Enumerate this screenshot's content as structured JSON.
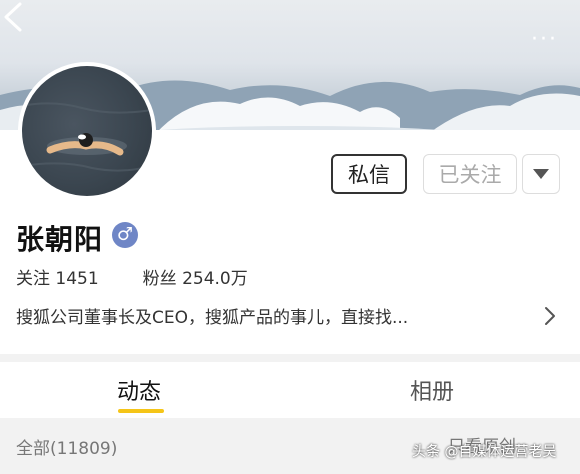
{
  "header": {
    "back_icon": "back-chevron-icon",
    "more_icon": "more-dots-icon",
    "more_text": "···"
  },
  "profile": {
    "name": "张朝阳",
    "gender_icon": "male-icon",
    "gender_symbol": "♂",
    "follow_stat": "关注 1451",
    "fans_stat": "粉丝 254.0万",
    "bio": "搜狐公司董事长及CEO，搜狐产品的事儿，直接找..."
  },
  "actions": {
    "message_label": "私信",
    "followed_label": "已关注"
  },
  "tabs": [
    {
      "label": "动态",
      "active": true
    },
    {
      "label": "相册",
      "active": false
    }
  ],
  "filter": {
    "all_label": "全部(11809)",
    "original_label": "只看原创"
  },
  "watermark": "头条 @自媒体运营老吴",
  "colors": {
    "accent": "#f5c518",
    "gender_badge": "#6f86c6"
  }
}
